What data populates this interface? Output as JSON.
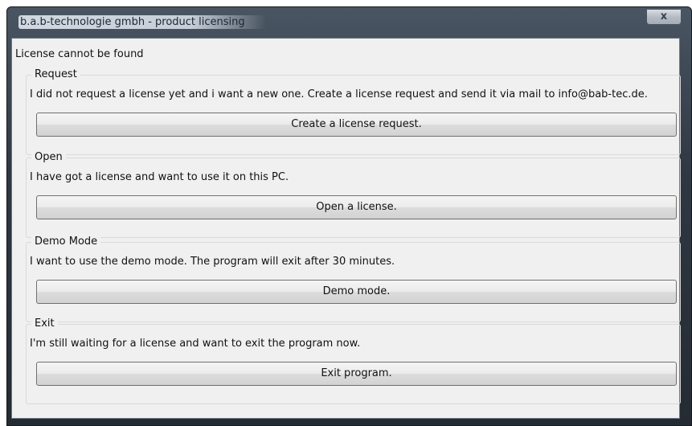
{
  "window": {
    "title": "b.a.b-technologie gmbh - product licensing",
    "close_label": "x"
  },
  "header": {
    "message": "License cannot be found"
  },
  "groups": [
    {
      "legend": "Request",
      "description": "I did not request a license yet and i want a new one. Create a license request and send it via mail to info@bab-tec.de.",
      "button": "Create a license request."
    },
    {
      "legend": "Open",
      "description": "I have got a license and want to use it on this PC.",
      "button": "Open a license."
    },
    {
      "legend": "Demo Mode",
      "description": "I want to use the demo mode. The program will exit after 30 minutes.",
      "button": "Demo mode."
    },
    {
      "legend": "Exit",
      "description": "I'm still waiting for a license and want to exit the program now.",
      "button": "Exit program."
    }
  ],
  "colors": {
    "frame": "#2f3742",
    "client_background": "#f0f0f0",
    "button_border": "#707070"
  },
  "icons": {
    "close": "close-icon"
  }
}
